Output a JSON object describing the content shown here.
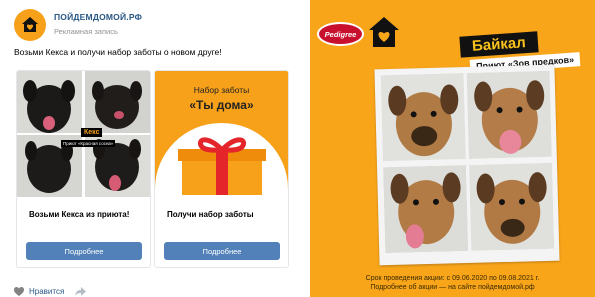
{
  "post": {
    "name": "ПОЙДЕМДОМОЙ.РФ",
    "subtitle": "Рекламная запись",
    "text": "Возьми Кекса и получи набор заботы о новом друге!",
    "cards": [
      {
        "title": "Возьми Кекса из приюта!",
        "button": "Подробнее",
        "tag": "Кекс",
        "tag_sub": "Приют «Красная сосна»"
      },
      {
        "title": "Получи набор заботы",
        "button": "Подробнее",
        "heading_line1": "Набор заботы",
        "heading_line2": "«Ты дома»"
      }
    ],
    "footer": {
      "like_label": "Нравится"
    }
  },
  "ad": {
    "logo": "Pedigree",
    "title": "Байкал",
    "subtitle": "Приют «Зов предков»",
    "footer_line1": "Срок проведения акции: с 09.06.2020 по 09.08.2021 г.",
    "footer_line2": "Подробнее об акции — на сайте пойдемдомой.рф"
  },
  "colors": {
    "brand_orange": "#f7a11a",
    "vk_blue": "#5181b8",
    "link_blue": "#2a5885",
    "pedigree_red": "#c8102e"
  }
}
